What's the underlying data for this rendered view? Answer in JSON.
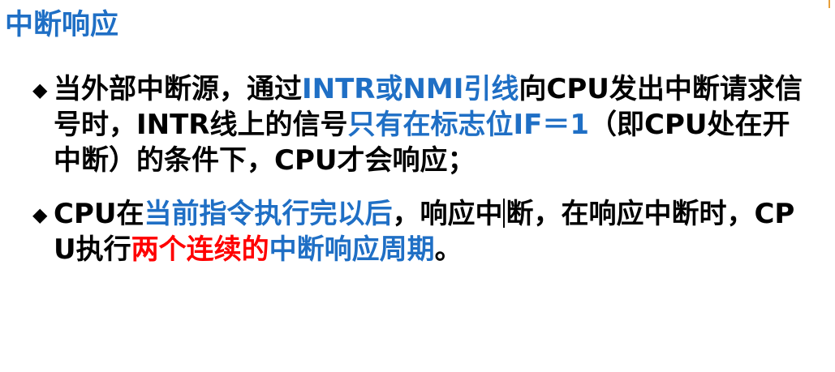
{
  "title": "中断响应",
  "bullet_symbol": "◆",
  "items": [
    {
      "segments": [
        {
          "text": "当外部中断源，通过",
          "color": "black"
        },
        {
          "text": "INTR或NMI引线",
          "color": "blue"
        },
        {
          "text": "向CPU发出中断请求信号时，INTR线上的信号",
          "color": "black"
        },
        {
          "text": "只有在标志位IF＝1",
          "color": "blue"
        },
        {
          "text": "（即CPU处在开中断）的条件下，CPU才会响应；",
          "color": "black"
        }
      ]
    },
    {
      "segments": [
        {
          "text": "CPU在",
          "color": "black"
        },
        {
          "text": "当前指令执行完以后",
          "color": "blue"
        },
        {
          "text": "，响应中",
          "color": "black"
        },
        {
          "text": "断，在响应中断时，CPU执行",
          "color": "black"
        },
        {
          "text": "两个连续的",
          "color": "red"
        },
        {
          "text": "中断响应周期",
          "color": "blue"
        },
        {
          "text": "。",
          "color": "black"
        }
      ]
    }
  ],
  "colors": {
    "black": "#000000",
    "blue": "#1f6fc5",
    "red": "#ff0000",
    "corner_mark": "#e8a03a"
  }
}
